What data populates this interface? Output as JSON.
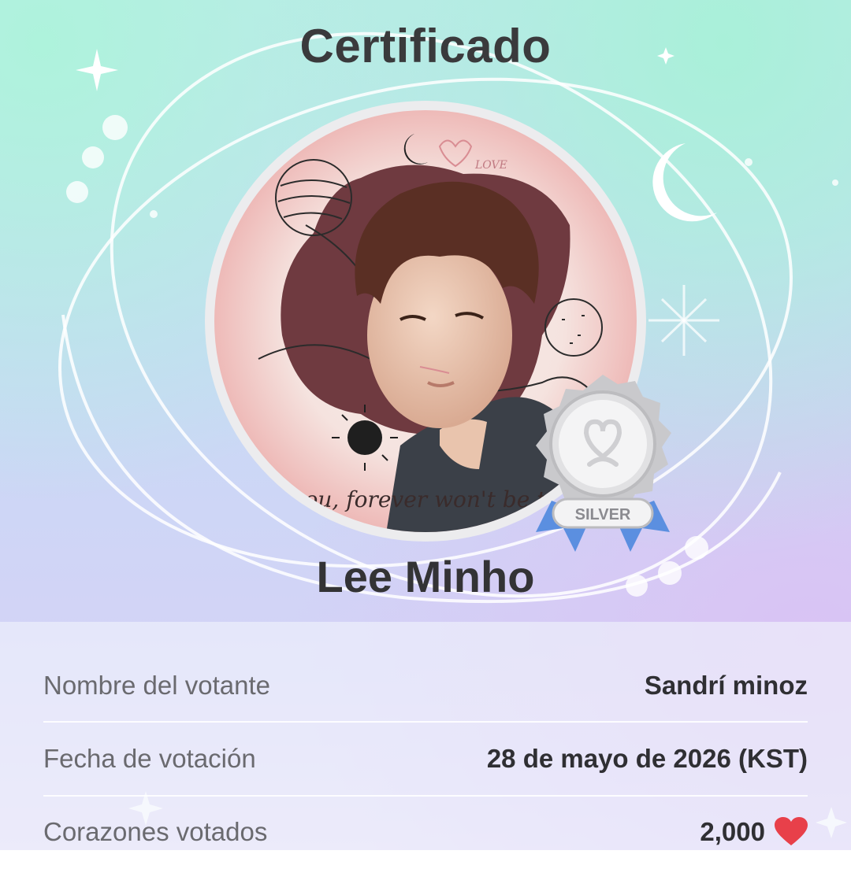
{
  "certificate": {
    "title": "Certificado",
    "artist_name": "Lee Minho",
    "badge": {
      "tier_label": "SILVER",
      "icon": "silver-medal-heart-icon"
    },
    "portrait": {
      "script_caption": "you, forever won't be to",
      "doodle_text": "LOVE"
    }
  },
  "details": [
    {
      "label": "Nombre del votante",
      "value": "Sandrí minoz"
    },
    {
      "label": "Fecha de votación",
      "value": "28 de mayo de 2026 (KST)"
    },
    {
      "label": "Corazones votados",
      "value": "2,000",
      "icon": "heart-icon"
    }
  ],
  "colors": {
    "title_text": "#3a3a3c",
    "heart": "#e8404a",
    "ribbon": "#5b8fe0",
    "medal_silver": "#c9c9cc"
  }
}
